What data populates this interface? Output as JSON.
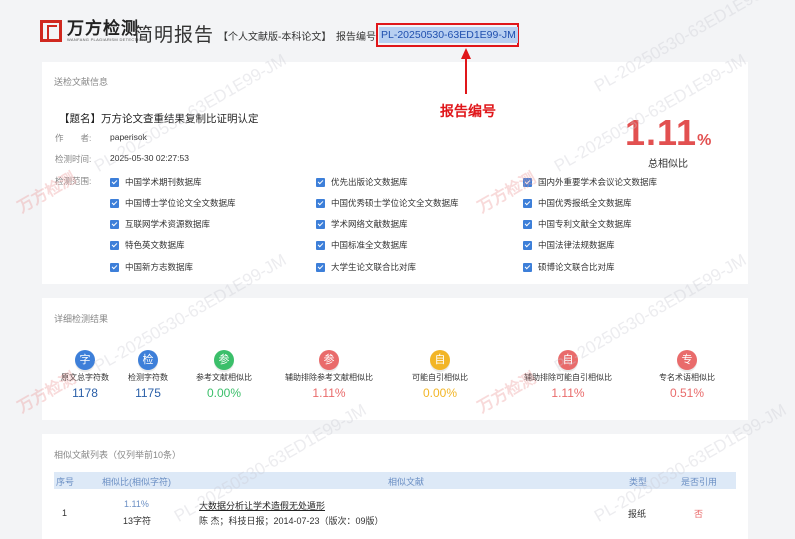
{
  "header": {
    "logo_text": "万方检测",
    "logo_sub": "WANFANG PLAGIARISM DETECTION",
    "title": "简明报告",
    "subtitle": "【个人文献版-本科论文】",
    "report_no_label": "报告编号",
    "report_no": "PL-20250530-63ED1E99-JM",
    "annotation": "报告编号"
  },
  "info": {
    "section_title": "送检文献信息",
    "doc_title": "【题名】万方论文查重结果复制比证明认定",
    "author_label": "作　　者:",
    "author": "paperisok",
    "time_label": "检测时间:",
    "time": "2025-05-30 02:27:53",
    "range_label": "检测范围:",
    "total_pct": "1.11",
    "total_pct_unit": "%",
    "total_caption": "总相似比",
    "databases": [
      "中国学术期刊数据库",
      "优先出版论文数据库",
      "国内外重要学术会议论文数据库",
      "中国博士学位论文全文数据库",
      "中国优秀硕士学位论文全文数据库",
      "中国优秀报纸全文数据库",
      "互联网学术资源数据库",
      "学术网络文献数据库",
      "中国专利文献全文数据库",
      "特色英文数据库",
      "中国标准全文数据库",
      "中国法律法规数据库",
      "中国新方志数据库",
      "大学生论文联合比对库",
      "硕博论文联合比对库"
    ]
  },
  "detail": {
    "section_title": "详细检测结果",
    "stats": [
      {
        "icon": "字",
        "label": "原文总字符数",
        "value": "1178",
        "color": "#3d7fd9",
        "value_color": "#2a5fa8"
      },
      {
        "icon": "检",
        "label": "检测字符数",
        "value": "1175",
        "color": "#3d7fd9",
        "value_color": "#2a5fa8"
      },
      {
        "icon": "参",
        "label": "参考文献相似比",
        "value": "0.00%",
        "color": "#3bbf6a",
        "value_color": "#3bbf6a"
      },
      {
        "icon": "参",
        "label": "辅助排除参考文献相似比",
        "value": "1.11%",
        "color": "#e96b6b",
        "value_color": "#e96b6b"
      },
      {
        "icon": "自",
        "label": "可能自引相似比",
        "value": "0.00%",
        "color": "#f2b526",
        "value_color": "#f2b526"
      },
      {
        "icon": "自",
        "label": "辅助排除可能自引相似比",
        "value": "1.11%",
        "color": "#e96b6b",
        "value_color": "#e96b6b"
      },
      {
        "icon": "专",
        "label": "专名术语相似比",
        "value": "0.51%",
        "color": "#e96b6b",
        "value_color": "#e96b6b"
      }
    ]
  },
  "similar": {
    "section_title": "相似文献列表（仅列举前10条）",
    "headers": {
      "no": "序号",
      "ratio": "相似比(相似字符)",
      "doc": "相似文献",
      "type": "类型",
      "cite": "是否引用"
    },
    "rows": [
      {
        "no": "1",
        "ratio": "1.11%",
        "chars": "13字符",
        "title": "大数据分析让学术造假无处遁形",
        "source": "陈 杰；科技日报；2014-07-23（版次：09版）",
        "type": "报纸",
        "cite": "否"
      }
    ]
  },
  "watermark": {
    "text": "PL-20250530-63ED1E99-JM",
    "logo": "万方检测"
  }
}
